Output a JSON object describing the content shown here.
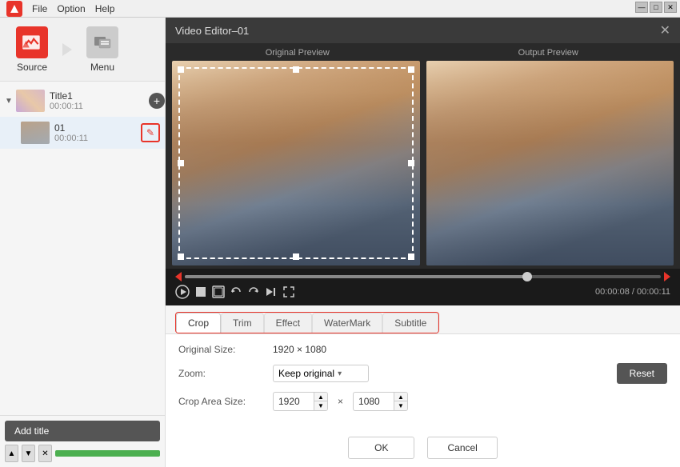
{
  "app": {
    "title": "Video Editor–01",
    "menu_items": [
      "File",
      "Option",
      "Help"
    ],
    "window_controls": [
      "—",
      "□",
      "✕"
    ]
  },
  "sidebar": {
    "source_label": "Source",
    "menu_label": "Menu",
    "groups": [
      {
        "name": "Title1",
        "time": "00:00:11",
        "items": [
          {
            "name": "01",
            "time": "00:00:11"
          }
        ]
      }
    ],
    "add_title_label": "Add title"
  },
  "editor": {
    "original_preview_label": "Original Preview",
    "output_preview_label": "Output Preview",
    "time_display": "00:00:08 / 00:00:11",
    "tabs": [
      "Crop",
      "Trim",
      "Effect",
      "WaterMark",
      "Subtitle"
    ],
    "active_tab": "Crop",
    "crop": {
      "original_size_label": "Original Size:",
      "original_size_value": "1920 × 1080",
      "zoom_label": "Zoom:",
      "zoom_value": "Keep original",
      "crop_area_label": "Crop Area Size:",
      "crop_width": "1920",
      "crop_x_label": "×",
      "crop_height": "1080",
      "reset_label": "Reset"
    },
    "ok_label": "OK",
    "cancel_label": "Cancel"
  }
}
